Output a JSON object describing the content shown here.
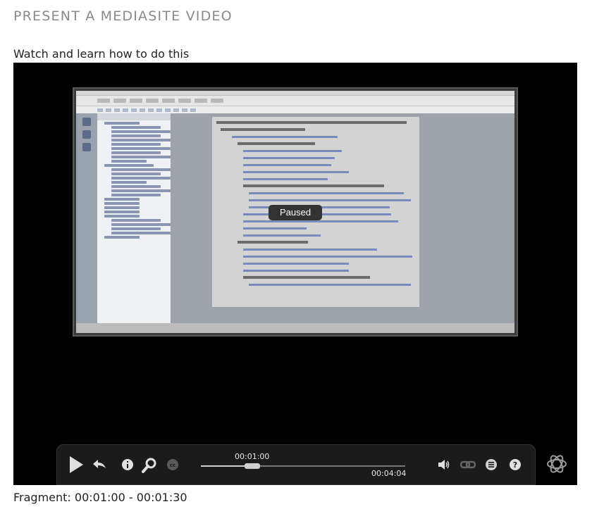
{
  "page": {
    "heading": "PRESENT A MEDIASITE VIDEO",
    "subheading": "Watch and learn how to do this",
    "fragment": "Fragment: 00:01:00 - 00:01:30"
  },
  "player": {
    "overlay_status": "Paused",
    "current_time": "00:01:00",
    "total_time": "00:04:04",
    "progress": 0.25
  },
  "controls": {
    "icons": [
      "play-icon",
      "rewind-icon",
      "info-icon",
      "search-icon",
      "closed-captions-icon",
      "volume-icon",
      "link-icon",
      "menu-icon",
      "help-icon",
      "mediasite-logo-icon"
    ]
  },
  "colors": {
    "player_bg": "#000000",
    "control_bar_bg": "#1b1b1b",
    "heading": "#8a8a8a"
  }
}
